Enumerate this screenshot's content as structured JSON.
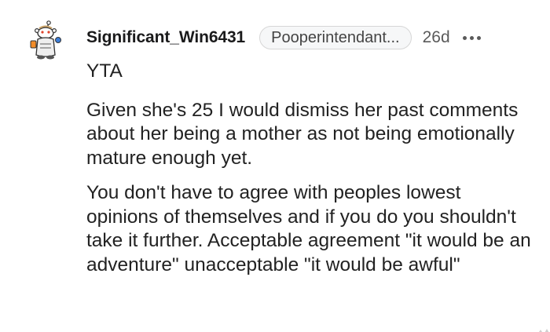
{
  "comment": {
    "author": "Significant_Win6431",
    "flair": "Pooperintendant...",
    "age": "26d",
    "avatar_icon": "snoo-avatar-icon",
    "more_icon": "more-options-icon",
    "paragraphs": [
      "YTA",
      "Given she's 25 I would dismiss her past comments about her being a mother as not being emotionally mature enough yet.",
      "You don't have to agree with peoples lowest opinions of themselves and if you do you shouldn't take it further. Acceptable agreement \"it would be an adventure\" unacceptable \"it would be awful\""
    ]
  }
}
